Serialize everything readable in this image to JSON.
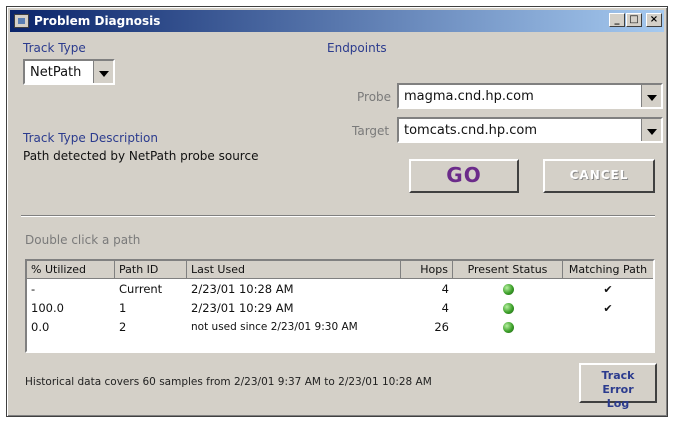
{
  "window": {
    "title": "Problem Diagnosis",
    "controls": [
      "_",
      "□",
      "×"
    ]
  },
  "track_type": {
    "label": "Track Type",
    "value": "NetPath"
  },
  "track_type_description": {
    "label": "Track Type Description",
    "text": "Path detected by NetPath probe source"
  },
  "endpoints": {
    "label": "Endpoints",
    "probe_label": "Probe",
    "probe_value": "magma.cnd.hp.com",
    "target_label": "Target",
    "target_value": "tomcats.cnd.hp.com"
  },
  "buttons": {
    "go": "GO",
    "cancel": "CANCEL",
    "track_error_log": "Track Error Log"
  },
  "table": {
    "caption": "Double click a path",
    "columns": [
      "% Utilized",
      "Path ID",
      "Last Used",
      "Hops",
      "Present Status",
      "Matching Path"
    ],
    "rows": [
      [
        "-",
        "Current",
        "2/23/01 10:28 AM",
        "4",
        "green",
        "✔"
      ],
      [
        "100.0",
        "1",
        "2/23/01 10:29 AM",
        "4",
        "green",
        "✔"
      ],
      [
        "0.0",
        "2",
        "not used since 2/23/01 9:30 AM",
        "26",
        "green",
        ""
      ]
    ]
  },
  "status_text": "Historical data covers 60 samples from 2/23/01 9:37 AM to 2/23/01 10:28 AM"
}
